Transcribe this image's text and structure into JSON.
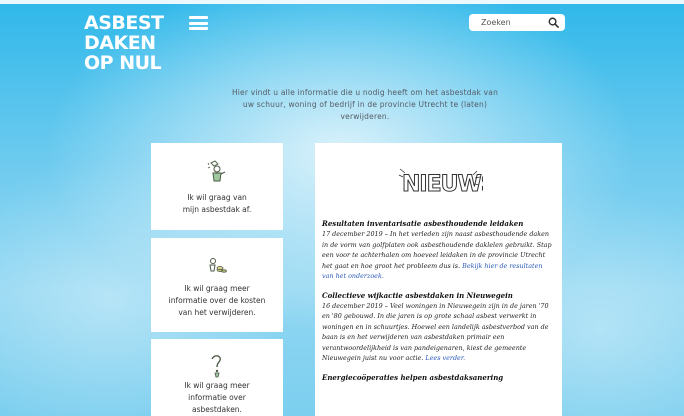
{
  "header": {
    "logo_lines": [
      "ASBEST",
      "DAKEN",
      "OP NUL"
    ],
    "search_placeholder": "Zoeken"
  },
  "intro": {
    "text": "Hier vindt u alle informatie die u nodig heeft om het asbestdak van uw schuur, woning of bedrijf in de provincie Utrecht te (laten) verwijderen."
  },
  "cards": [
    {
      "label_1": "Ik wil graag van",
      "label_2": "mijn asbestdak af.",
      "icon": "person-icon"
    },
    {
      "label_1": "Ik wil graag meer",
      "label_2": "informatie over de kosten",
      "label_3": "van het verwijderen.",
      "icon": "money-icon"
    },
    {
      "label_1": "Ik wil graag meer",
      "label_2": "informatie over",
      "label_3": "asbestdaken.",
      "icon": "question-icon"
    }
  ],
  "news": {
    "logo_text": "NIEUWS",
    "items": [
      {
        "title": "Resultaten inventarisatie asbesthoudende leidaken",
        "body": "17 december 2019 – In het verleden zijn naast asbesthoudende daken in de vorm van golfplaten ook asbesthoudende daklelen gebruikt. Stap een voor te achterhalen om hoeveel leidaken in de provincie Utrecht het gaat en hoe groot het probleem dus is.",
        "link": "Bekijk hier de resultaten van het onderzoek."
      },
      {
        "title": "Collectieve wijkactie asbestdaken in Nieuwegein",
        "body": "16 december 2019 – Veel woningen in Nieuwegein zijn in de jaren '70 en '80 gebouwd. In die jaren is op grote schaal asbest verwerkt in woningen en in schuurtjes. Hoewel een landelijk asbestverbod van de baan is en het verwijderen van asbestdaken primair een verantwoordelijkheid is van pandeigenaren, kiest de gemeente Nieuwegein juist nu voor actie.",
        "link": "Lees verder."
      },
      {
        "title": "Energiecoöperaties helpen asbestdaksanering",
        "body": "",
        "link": ""
      }
    ]
  }
}
